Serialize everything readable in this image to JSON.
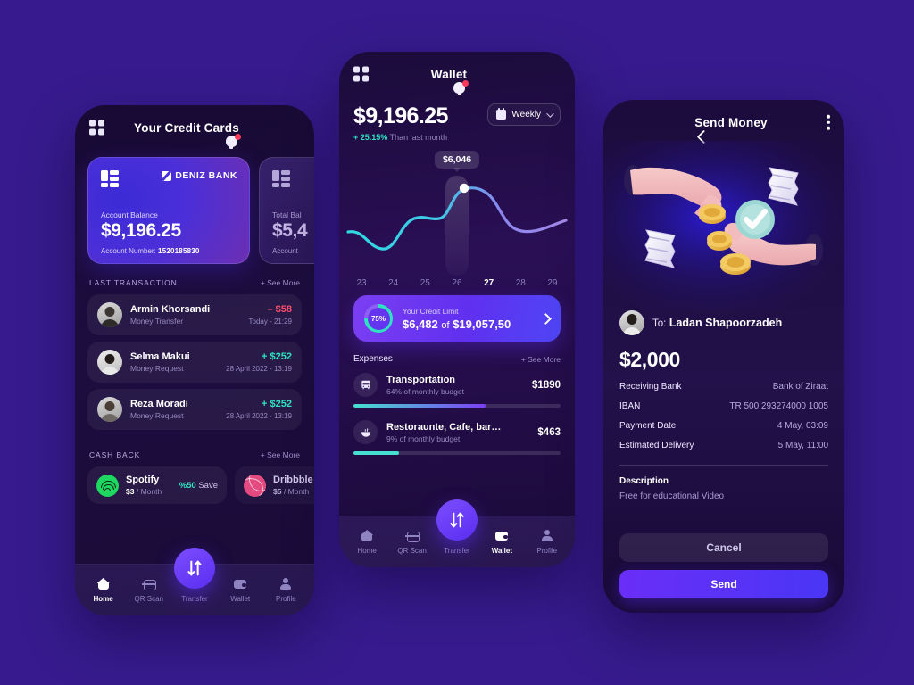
{
  "background_color": "#371B8E",
  "accent": {
    "purple": "#5a2ef0",
    "teal": "#2fe3c0",
    "red": "#ff4d6d"
  },
  "phone_cards": {
    "header": {
      "title": "Your Credit Cards",
      "menu_icon": "grid-menu-icon",
      "notification_icon": "bell-icon"
    },
    "cards": [
      {
        "bank": "DENIZ BANK",
        "label": "Account Balance",
        "balance": "$9,196.25",
        "number_label": "Account Number:",
        "number": "1520185830"
      },
      {
        "bank": "",
        "label": "Total Bal",
        "balance": "$5,4",
        "number_label": "Account",
        "number": ""
      }
    ],
    "transactions_section": {
      "title": "LAST TRANSACTION",
      "see_more": "+ See More"
    },
    "transactions": [
      {
        "name": "Armin Khorsandi",
        "type": "Money Transfer",
        "amount": "– $58",
        "sign": "neg",
        "time": "Today - 21:29"
      },
      {
        "name": "Selma Makui",
        "type": "Money Request",
        "amount": "+ $252",
        "sign": "pos",
        "time": "28 April 2022 - 13:19"
      },
      {
        "name": "Reza Moradi",
        "type": "Money Request",
        "amount": "+ $252",
        "sign": "pos",
        "time": "28 April 2022 - 13:19"
      }
    ],
    "cashback_section": {
      "title": "CASH BACK",
      "see_more": "+ See More"
    },
    "cashback": [
      {
        "name": "Spotify",
        "price": "$3",
        "period": "/ Month",
        "save_pct": "%50",
        "save_label": "Save",
        "logo": "spotify-logo"
      },
      {
        "name": "Dribbble",
        "price": "$5",
        "period": "/ Month",
        "save_pct": "",
        "save_label": "",
        "logo": "dribbble-logo"
      }
    ],
    "nav": {
      "active": "Home",
      "items": [
        {
          "label": "Home",
          "icon": "home-icon"
        },
        {
          "label": "QR Scan",
          "icon": "qr-scan-icon"
        },
        {
          "label": "Transfer",
          "icon": "transfer-icon"
        },
        {
          "label": "Wallet",
          "icon": "wallet-icon"
        },
        {
          "label": "Profile",
          "icon": "profile-icon"
        }
      ]
    }
  },
  "phone_wallet": {
    "header": {
      "title": "Wallet",
      "menu_icon": "grid-menu-icon",
      "notification_icon": "bell-icon"
    },
    "balance": "$9,196.25",
    "delta_value": "+ 25.15%",
    "delta_label": "Than last month",
    "period_selector": {
      "label": "Weekly",
      "icon": "calendar-icon",
      "chevron": "chevron-down-icon"
    },
    "credit_limit": {
      "percent": "75%",
      "title": "Your Credit Limit",
      "used": "$6,482",
      "of": "of",
      "total": "$19,057,50"
    },
    "expenses_section": {
      "title": "Expenses",
      "see_more": "+ See More"
    },
    "expenses": [
      {
        "name": "Transportation",
        "sub": "64% of monthly budget",
        "amount": "$1890",
        "pct": 64,
        "icon": "bus-icon"
      },
      {
        "name": "Restoraunte, Cafe, bar…",
        "sub": "9% of monthly budget",
        "amount": "$463",
        "pct": 22,
        "icon": "noodle-bowl-icon"
      }
    ],
    "nav": {
      "active": "Wallet",
      "items": [
        {
          "label": "Home",
          "icon": "home-icon"
        },
        {
          "label": "QR Scan",
          "icon": "qr-scan-icon"
        },
        {
          "label": "Transfer",
          "icon": "transfer-icon"
        },
        {
          "label": "Wallet",
          "icon": "wallet-icon"
        },
        {
          "label": "Profile",
          "icon": "profile-icon"
        }
      ]
    }
  },
  "chart_data": {
    "type": "line",
    "title": "",
    "categories": [
      "23",
      "24",
      "25",
      "26",
      "27",
      "28",
      "29"
    ],
    "values": [
      3900,
      2900,
      4900,
      4550,
      6046,
      5200,
      4300
    ],
    "xlabel": "",
    "ylabel": "",
    "highlight": {
      "category": "27",
      "label": "$6,046"
    },
    "grid": false,
    "legend": "none",
    "line_gradient": [
      "#2fd9e0",
      "#9b7bf0"
    ]
  },
  "phone_send": {
    "header": {
      "title": "Send Money",
      "back_icon": "back-chevron-icon",
      "more_icon": "kebab-menu-icon"
    },
    "illustration": "hands-exchanging-money-3d-illustration",
    "recipient_prefix": "To:",
    "recipient": "Ladan Shapoorzadeh",
    "amount": "$2,000",
    "details": [
      {
        "label": "Receiving Bank",
        "value": "Bank of  Ziraat"
      },
      {
        "label": "IBAN",
        "value": "TR 500 293274000 1005"
      },
      {
        "label": "Payment Date",
        "value": "4 May, 03:09"
      },
      {
        "label": "Estimated Delivery",
        "value": "5 May, 11:00"
      }
    ],
    "description_label": "Description",
    "description_value": "Free for educational Video",
    "cancel_label": "Cancel",
    "send_label": "Send"
  }
}
